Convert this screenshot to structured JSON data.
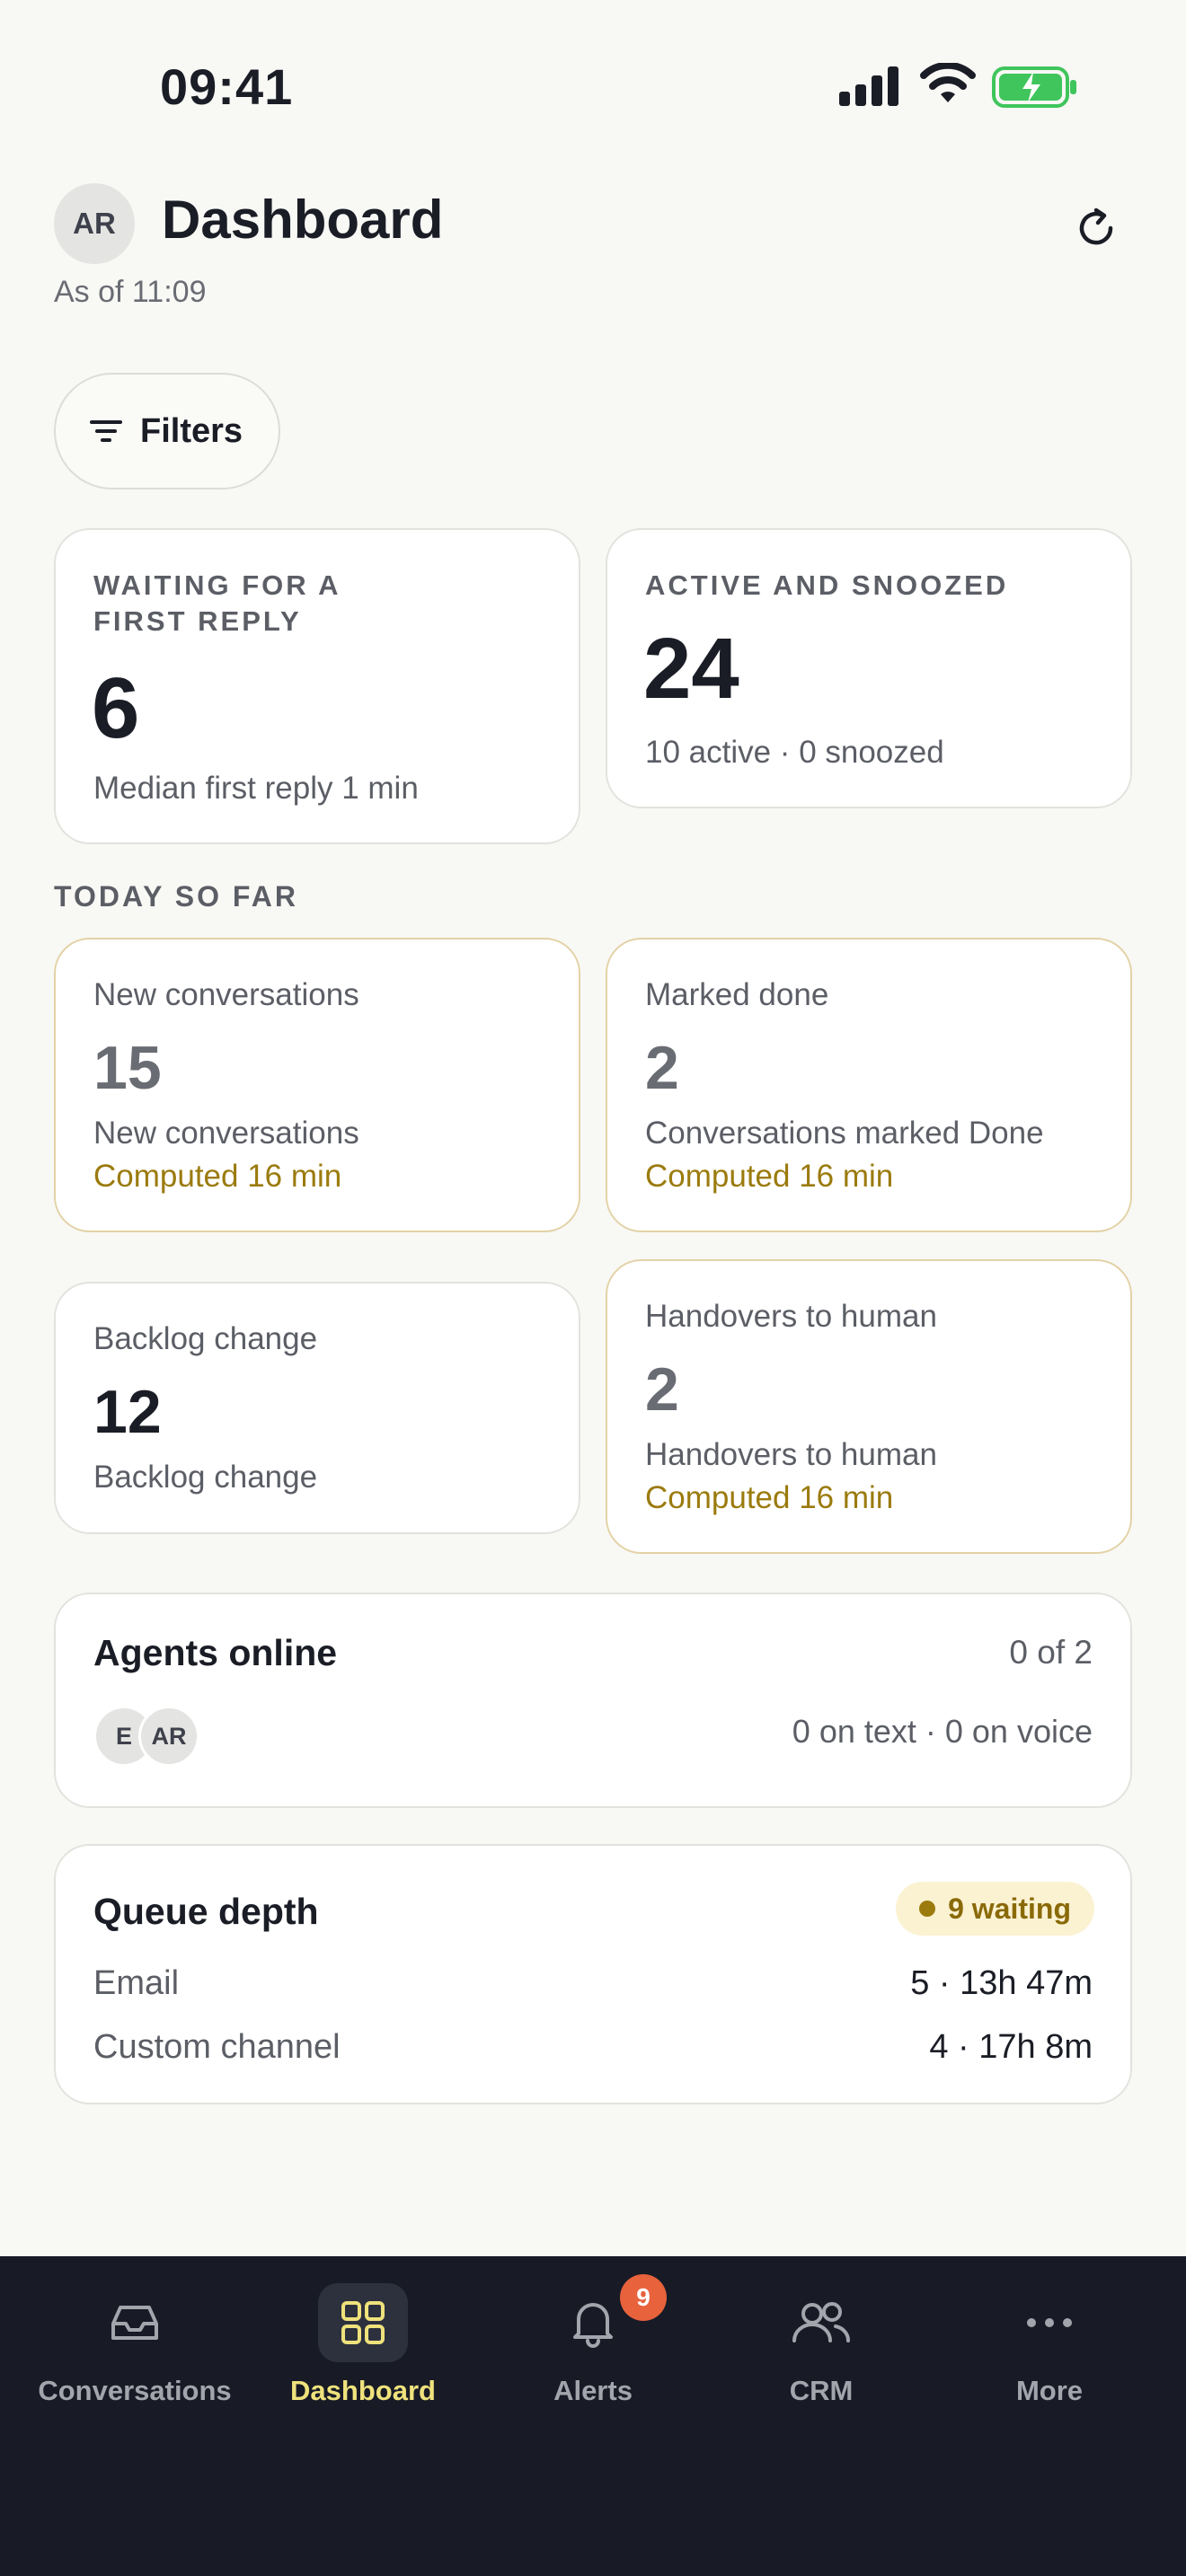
{
  "status_bar": {
    "time": "09:41"
  },
  "header": {
    "avatar_initials": "AR",
    "title": "Dashboard",
    "subtitle": "As of 11:09"
  },
  "filters": {
    "label": "Filters"
  },
  "kpis": [
    {
      "label": "WAITING FOR A FIRST REPLY",
      "value": "6",
      "sub": "Median first reply 1 min"
    },
    {
      "label": "ACTIVE AND SNOOZED",
      "value": "24",
      "sub": "10 active · 0 snoozed"
    }
  ],
  "today": {
    "section_label": "TODAY SO FAR",
    "tiles": [
      {
        "label": "New conversations",
        "value": "15",
        "desc": "New conversations",
        "computed": "Computed 16 min"
      },
      {
        "label": "Marked done",
        "value": "2",
        "desc": "Conversations marked Done",
        "computed": "Computed 16 min"
      },
      {
        "label": "Backlog change",
        "value": "12",
        "desc": "Backlog change"
      },
      {
        "label": "Handovers to human",
        "value": "2",
        "desc": "Handovers to human",
        "computed": "Computed 16 min"
      }
    ]
  },
  "agents": {
    "title": "Agents online",
    "count": "0 of 2",
    "avatars": [
      "E",
      "AR"
    ],
    "meta": "0 on text · 0 on voice"
  },
  "queue": {
    "title": "Queue depth",
    "badge": "9 waiting",
    "rows": [
      {
        "label": "Email",
        "value": "5 · 13h 47m"
      },
      {
        "label": "Custom channel",
        "value": "4 · 17h 8m"
      }
    ]
  },
  "tabbar": {
    "tabs": [
      {
        "label": "Conversations",
        "icon": "inbox-icon"
      },
      {
        "label": "Dashboard",
        "icon": "grid-icon",
        "active": true
      },
      {
        "label": "Alerts",
        "icon": "bell-icon",
        "badge": "9"
      },
      {
        "label": "CRM",
        "icon": "users-icon"
      },
      {
        "label": "More",
        "icon": "more-icon"
      }
    ]
  },
  "colors": {
    "background": "#f8f8f5",
    "accent_gold": "#9b7b0e",
    "tab_active": "#efe27c",
    "tabbar_bg": "#181b26",
    "alert_badge": "#e8623c",
    "battery_green": "#3fc55c"
  }
}
